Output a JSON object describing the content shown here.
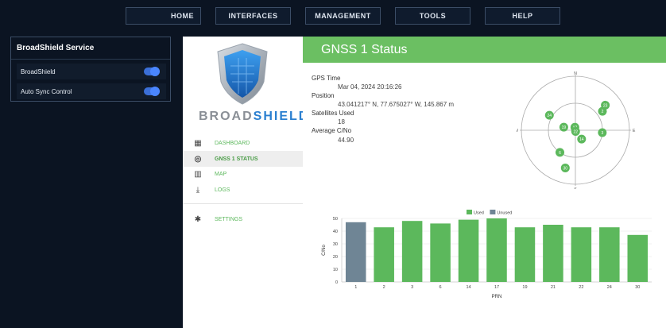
{
  "nav": {
    "items": [
      "HOME",
      "INTERFACES",
      "MANAGEMENT",
      "TOOLS",
      "HELP"
    ]
  },
  "service": {
    "title": "BroadShield Service",
    "rows": [
      {
        "label": "BroadShield",
        "on": true
      },
      {
        "label": "Auto Sync Control",
        "on": true
      }
    ]
  },
  "logo": {
    "broad": "BROAD",
    "shield": "SHIELD"
  },
  "menu": [
    {
      "label": "DASHBOARD",
      "icon": "dashboard-icon"
    },
    {
      "label": "GNSS 1 STATUS",
      "icon": "target-icon",
      "active": true
    },
    {
      "label": "MAP",
      "icon": "map-icon"
    },
    {
      "label": "LOGS",
      "icon": "download-icon"
    },
    {
      "label": "SETTINGS",
      "icon": "gear-icon"
    }
  ],
  "page": {
    "title": "GNSS 1 Status"
  },
  "status": {
    "gps_time_label": "GPS Time",
    "gps_time": "Mar 04, 2024 20:16:26",
    "position_label": "Position",
    "position": "43.041217° N, 77.675027° W, 145.867 m",
    "sats_label": "Satellites Used",
    "sats": "18",
    "cno_label": "Average C/No",
    "cno": "44.90"
  },
  "skyplot": {
    "directions": [
      "N",
      "E",
      "S",
      "W"
    ],
    "satellites": [
      {
        "prn": "24",
        "az": 300,
        "el": 40
      },
      {
        "prn": "23",
        "az": 50,
        "el": 25
      },
      {
        "prn": "2",
        "az": 55,
        "el": 35
      },
      {
        "prn": "19",
        "az": 285,
        "el": 70
      },
      {
        "prn": "17",
        "az": 350,
        "el": 85
      },
      {
        "prn": "22",
        "az": 170,
        "el": 88
      },
      {
        "prn": "3",
        "az": 95,
        "el": 45
      },
      {
        "prn": "14",
        "az": 145,
        "el": 72
      },
      {
        "prn": "6",
        "az": 215,
        "el": 45
      },
      {
        "prn": "30",
        "az": 195,
        "el": 25
      }
    ]
  },
  "chart_data": {
    "type": "bar",
    "categories": [
      "1",
      "2",
      "3",
      "6",
      "14",
      "17",
      "19",
      "21",
      "22",
      "24",
      "30"
    ],
    "values": [
      47,
      43,
      48,
      46,
      49,
      50,
      43,
      45,
      43,
      43,
      37
    ],
    "status": [
      "Unused",
      "Used",
      "Used",
      "Used",
      "Used",
      "Used",
      "Used",
      "Used",
      "Used",
      "Used",
      "Used"
    ],
    "legend": [
      "Used",
      "Unused"
    ],
    "colors": {
      "Used": "#5cb85c",
      "Unused": "#6f8595"
    },
    "xlabel": "PRN",
    "ylabel": "C/No",
    "ylim": [
      0,
      50
    ],
    "yticks": [
      0,
      10,
      20,
      30,
      40,
      50
    ],
    "legend_position": "top"
  }
}
